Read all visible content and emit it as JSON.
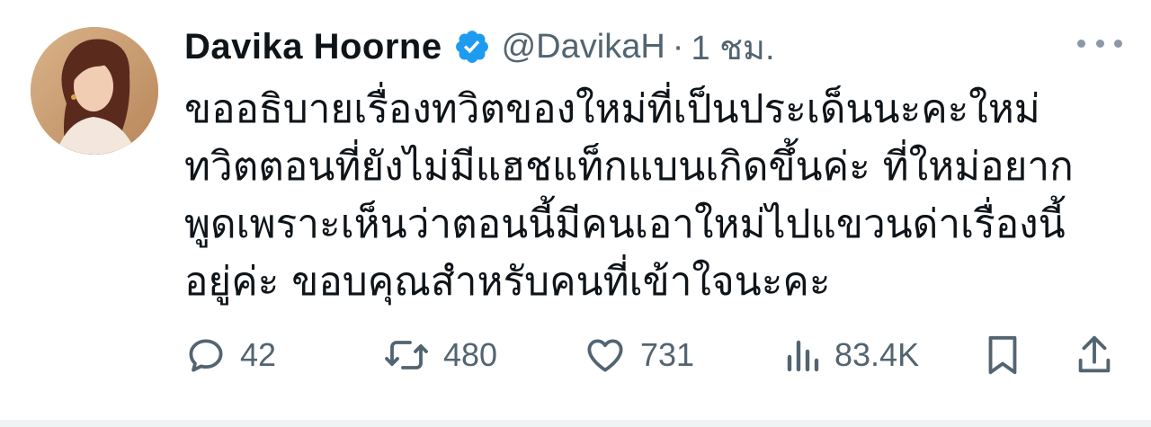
{
  "author": {
    "display_name": "Davika Hoorne",
    "handle": "@DavikaH",
    "separator": "·",
    "time": "1 ชม.",
    "verified": true
  },
  "tweet": {
    "lines": [
      "ขออธิบายเรื่องทวิตของใหม่ที่เป็นประเด็นนะคะใหม่",
      "ทวิตตอนที่ยังไม่มีแฮชแท็กแบนเกิดขึ้นค่ะ ที่ใหม่อยาก",
      "พูดเพราะเห็นว่าตอนนี้มีคนเอาใหม่ไปแขวนด่าเรื่องนี้",
      "อยู่ค่ะ ขอบคุณสำหรับคนที่เข้าใจนะคะ"
    ]
  },
  "actions": {
    "replies": "42",
    "retweets": "480",
    "likes": "731",
    "views": "83.4K"
  },
  "icons": {
    "verified": "verified-badge-icon",
    "more": "more-horizontal-icon",
    "reply": "reply-bubble-icon",
    "retweet": "retweet-icon",
    "like": "heart-icon",
    "views": "views-bars-icon",
    "bookmark": "bookmark-icon",
    "share": "share-upload-icon"
  },
  "colors": {
    "verified_blue": "#1d9bf0",
    "text": "#0f1419",
    "muted": "#536471"
  }
}
